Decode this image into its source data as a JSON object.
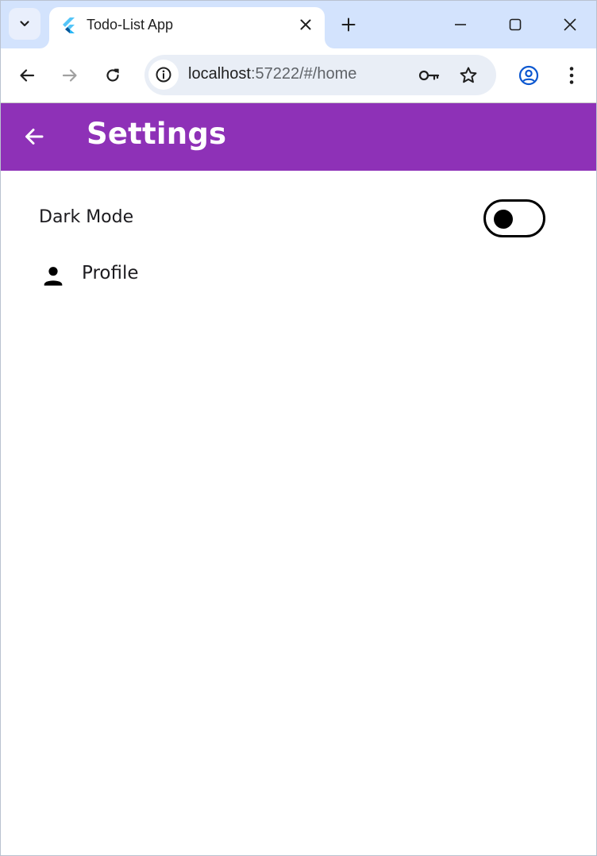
{
  "browser": {
    "tab": {
      "title": "Todo-List App",
      "favicon": "flutter-logo-icon"
    },
    "new_tab_icon": "plus-icon",
    "window_controls": [
      "minimize-icon",
      "maximize-icon",
      "close-icon"
    ],
    "address_bar": {
      "host": "localhost",
      "path": ":57222/#/home"
    },
    "icons": {
      "site_info": "info-icon",
      "password": "key-icon",
      "bookmark": "star-icon",
      "profile": "account-circle-icon",
      "menu": "more-vert-icon"
    },
    "colors": {
      "tabstrip": "#d3e3fd",
      "omnibox": "#e9eef6",
      "profile_accent": "#0b57d0"
    }
  },
  "app": {
    "appbar": {
      "title": "Settings",
      "back_icon": "arrow-back-icon",
      "color": "#8e31b7"
    },
    "settings": {
      "dark_mode": {
        "label": "Dark Mode",
        "enabled": false
      },
      "profile": {
        "label": "Profile",
        "icon": "person-icon"
      }
    }
  }
}
